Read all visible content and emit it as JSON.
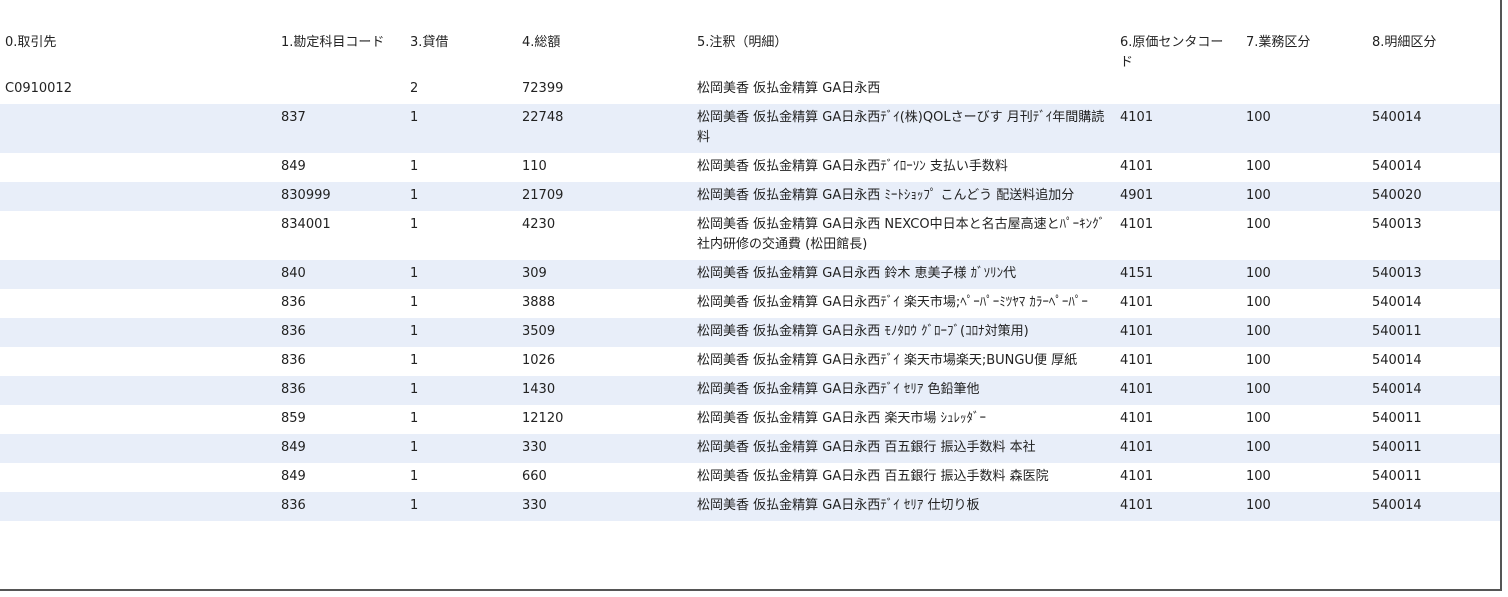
{
  "columns": [
    "0.取引先",
    "1.勘定科目コード",
    "3.貸借",
    "4.総額",
    "5.注釈（明細）",
    "6.原価センタコード",
    "7.業務区分",
    "8.明細区分"
  ],
  "rows": [
    [
      "C0910012",
      "",
      "2",
      "72399",
      "松岡美香 仮払金精算 GA日永西",
      "",
      "",
      ""
    ],
    [
      "",
      "837",
      "1",
      "22748",
      "松岡美香 仮払金精算 GA日永西ﾃﾞｲ(株)QOLさーびす 月刊ﾃﾞｲ年間購読料",
      "4101",
      "100",
      "540014"
    ],
    [
      "",
      "849",
      "1",
      "110",
      "松岡美香 仮払金精算 GA日永西ﾃﾞｲﾛｰｿﾝ 支払い手数料",
      "4101",
      "100",
      "540014"
    ],
    [
      "",
      "830999",
      "1",
      "21709",
      "松岡美香 仮払金精算 GA日永西 ﾐｰﾄｼｮｯﾌﾟ こんどう 配送料追加分",
      "4901",
      "100",
      "540020"
    ],
    [
      "",
      "834001",
      "1",
      "4230",
      "松岡美香 仮払金精算 GA日永西 NEXCO中日本と名古屋高速とﾊﾟｰｷﾝｸﾞ 社内研修の交通費 (松田館長)",
      "4101",
      "100",
      "540013"
    ],
    [
      "",
      "840",
      "1",
      "309",
      "松岡美香 仮払金精算 GA日永西 鈴木 恵美子様 ｶﾞｿﾘﾝ代",
      "4151",
      "100",
      "540013"
    ],
    [
      "",
      "836",
      "1",
      "3888",
      "松岡美香 仮払金精算 GA日永西ﾃﾞｲ 楽天市場;ﾍﾟｰﾊﾟｰﾐﾂﾔﾏ ｶﾗｰﾍﾟｰﾊﾟｰ",
      "4101",
      "100",
      "540014"
    ],
    [
      "",
      "836",
      "1",
      "3509",
      "松岡美香 仮払金精算 GA日永西 ﾓﾉﾀﾛｳ ｸﾞﾛｰﾌﾞ(ｺﾛﾅ対策用)",
      "4101",
      "100",
      "540011"
    ],
    [
      "",
      "836",
      "1",
      "1026",
      "松岡美香 仮払金精算 GA日永西ﾃﾞｲ 楽天市場楽天;BUNGU便 厚紙",
      "4101",
      "100",
      "540014"
    ],
    [
      "",
      "836",
      "1",
      "1430",
      "松岡美香 仮払金精算 GA日永西ﾃﾞｲ ｾﾘｱ 色鉛筆他",
      "4101",
      "100",
      "540014"
    ],
    [
      "",
      "859",
      "1",
      "12120",
      "松岡美香 仮払金精算 GA日永西 楽天市場 ｼｭﾚｯﾀﾞｰ",
      "4101",
      "100",
      "540011"
    ],
    [
      "",
      "849",
      "1",
      "330",
      "松岡美香 仮払金精算 GA日永西 百五銀行 振込手数料 本社",
      "4101",
      "100",
      "540011"
    ],
    [
      "",
      "849",
      "1",
      "660",
      "松岡美香 仮払金精算 GA日永西 百五銀行 振込手数料 森医院",
      "4101",
      "100",
      "540011"
    ],
    [
      "",
      "836",
      "1",
      "330",
      "松岡美香 仮払金精算 GA日永西ﾃﾞｲ ｾﾘｱ 仕切り板",
      "4101",
      "100",
      "540014"
    ]
  ]
}
